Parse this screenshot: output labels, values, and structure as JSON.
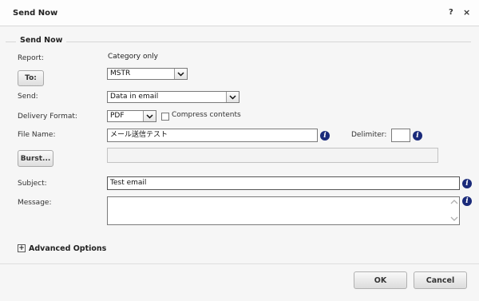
{
  "dialog": {
    "title": "Send Now",
    "help_label": "?",
    "close_label": "×"
  },
  "section": {
    "legend": "Send Now"
  },
  "report": {
    "label": "Report:",
    "value": "Category only"
  },
  "to": {
    "button_label": "To:",
    "selected": "MSTR"
  },
  "send": {
    "label": "Send:",
    "selected": "Data in email"
  },
  "delivery": {
    "label": "Delivery Format:",
    "selected": "PDF",
    "compress_label": "Compress contents",
    "compress_checked": false
  },
  "file_name": {
    "label": "File Name:",
    "value": "メール送信テスト"
  },
  "delimiter": {
    "label": "Delimiter:",
    "value": ""
  },
  "burst": {
    "button_label": "Burst...",
    "value": ""
  },
  "subject": {
    "label": "Subject:",
    "value": "Test email"
  },
  "message": {
    "label": "Message:",
    "value": ""
  },
  "advanced": {
    "toggle_symbol": "+",
    "label": "Advanced Options"
  },
  "footer": {
    "ok_label": "OK",
    "cancel_label": "Cancel"
  },
  "icons": {
    "info": "i",
    "dropdown": "chevron-down-icon",
    "scroll_up": "chevron-up-icon",
    "scroll_down": "chevron-down-icon"
  }
}
